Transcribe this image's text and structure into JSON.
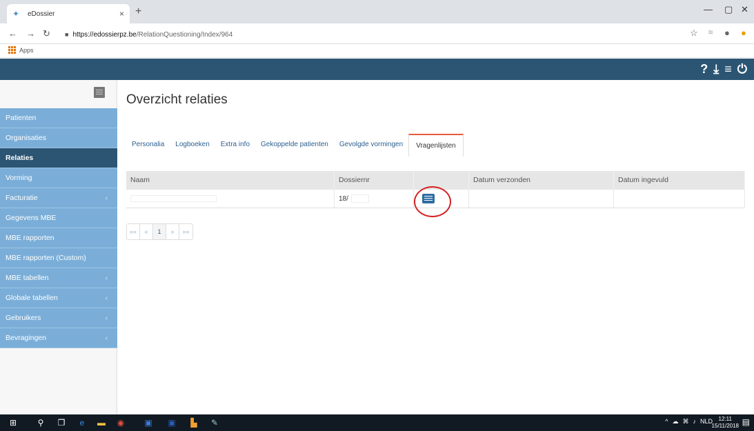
{
  "browser": {
    "tab_title": "eDossier",
    "tab_close": "×",
    "new_tab": "+",
    "url_host": "https://edossierpz.be",
    "url_path": "/RelationQuestioning/Index/964",
    "bookmark_apps": "Apps"
  },
  "sidebar": {
    "items": [
      {
        "label": "Patienten",
        "chevron": ""
      },
      {
        "label": "Organisaties",
        "chevron": ""
      },
      {
        "label": "Relaties",
        "chevron": ""
      },
      {
        "label": "Vorming",
        "chevron": ""
      },
      {
        "label": "Facturatie",
        "chevron": "‹"
      },
      {
        "label": "Gegevens MBE",
        "chevron": ""
      },
      {
        "label": "MBE rapporten",
        "chevron": ""
      },
      {
        "label": "MBE rapporten (Custom)",
        "chevron": ""
      },
      {
        "label": "MBE tabellen",
        "chevron": "‹"
      },
      {
        "label": "Globale tabellen",
        "chevron": "‹"
      },
      {
        "label": "Gebruikers",
        "chevron": "‹"
      },
      {
        "label": "Bevragingen",
        "chevron": "‹"
      }
    ]
  },
  "main": {
    "title": "Overzicht relaties",
    "tabs": [
      "Personalia",
      "Logboeken",
      "Extra info",
      "Gekoppelde patienten",
      "Gevolgde vormingen",
      "Vragenlijsten"
    ],
    "table": {
      "headers": [
        "Naam",
        "Dossiernr",
        "",
        "Datum verzonden",
        "Datum ingevuld"
      ],
      "row": {
        "naam": "",
        "dossiernr": "18/",
        "datum_verzonden": "",
        "datum_ingevuld": ""
      }
    },
    "pager": [
      "««",
      "«",
      "1",
      "»",
      "»»"
    ]
  },
  "header_icons": [
    "?",
    "⤓",
    "≡",
    "⏻"
  ],
  "taskbar": {
    "lang": "NLD",
    "time": "12:11",
    "date": "15/11/2018"
  },
  "colors": {
    "header": "#2b5573",
    "sidebar_item": "#7aaed8",
    "active_tab_border": "#e65b3c",
    "highlight_circle": "#d62020"
  }
}
